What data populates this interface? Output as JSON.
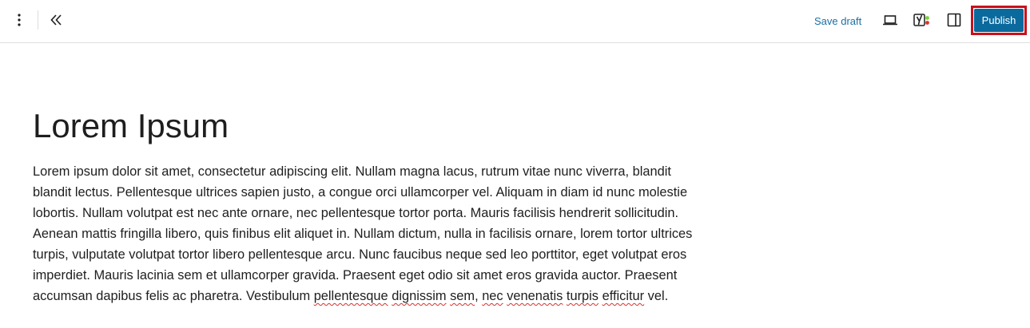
{
  "toolbar": {
    "options_icon": "vertical-ellipsis-icon",
    "collapse_icon": "double-chevron-left-icon",
    "save_draft_label": "Save draft",
    "preview_icon": "laptop-icon",
    "yoast_icon": "yoast-seo-icon",
    "settings_icon": "sidebar-panel-icon",
    "publish_label": "Publish"
  },
  "colors": {
    "accent": "#0a6a9e",
    "link": "#1a6ea3",
    "highlight_border": "#c8101b",
    "yoast_dot_green": "#7ad03a",
    "yoast_dot_red": "#dc3232"
  },
  "post": {
    "title": "Lorem Ipsum",
    "body_part1": "Lorem ipsum dolor sit amet, consectetur adipiscing elit. Nullam magna lacus, rutrum vitae nunc viverra, blandit blandit lectus. Pellentesque ultrices sapien justo, a congue orci ullamcorper vel. Aliquam in diam id nunc molestie lobortis. Nullam volutpat est nec ante ornare, nec pellentesque tortor porta. Mauris facilisis hendrerit sollicitudin. Aenean mattis fringilla libero, quis finibus elit aliquet in. Nullam dictum, nulla in facilisis ornare, lorem tortor ultrices turpis, vulputate volutpat tortor libero pellentesque arcu. Nunc faucibus neque sed leo porttitor, eget volutpat eros imperdiet. Mauris lacinia sem et ullamcorper gravida. Praesent eget odio sit amet eros gravida auctor. Praesent accumsan dapibus felis ac pharetra. Vestibulum ",
    "body_spell_1": "pellentesque",
    "body_space_1": " ",
    "body_spell_2": "dignissim",
    "body_space_2": " ",
    "body_spell_3": "sem",
    "body_part2": ", ",
    "body_spell_4": "nec",
    "body_space_3": " ",
    "body_spell_5": "venenatis",
    "body_space_4": " ",
    "body_spell_6": "turpis",
    "body_space_5": " ",
    "body_spell_7": "efficitur",
    "body_part3": " vel."
  }
}
